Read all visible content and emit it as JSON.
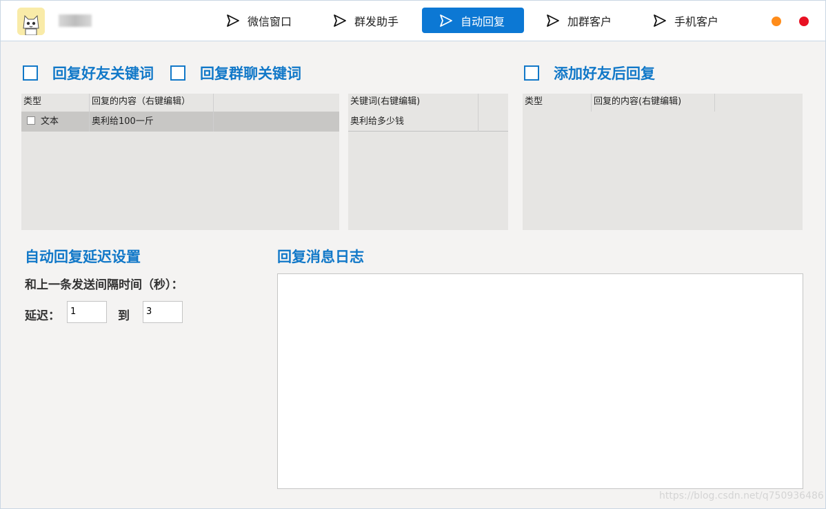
{
  "nav": {
    "tabs": [
      {
        "label": "微信窗口",
        "active": false
      },
      {
        "label": "群发助手",
        "active": false
      },
      {
        "label": "自动回复",
        "active": true
      },
      {
        "label": "加群客户",
        "active": false
      },
      {
        "label": "手机客户",
        "active": false
      }
    ]
  },
  "window_controls": {
    "minimize_color": "#ff8c1a",
    "close_color": "#e81123"
  },
  "keywords": {
    "friend_label": "回复好友关键词",
    "group_label": "回复群聊关键词",
    "after_add_label": "添加好友后回复"
  },
  "reply_table": {
    "col_type": "类型",
    "col_content": "回复的内容（右键编辑）",
    "rows": [
      {
        "type": "文本",
        "content": "奥利给100一斤"
      }
    ]
  },
  "keyword_table": {
    "col_keyword": "关键词(右键编辑)",
    "rows": [
      {
        "keyword": "奥利给多少钱"
      }
    ]
  },
  "add_reply_table": {
    "col_type": "类型",
    "col_content": "回复的内容(右键编辑)"
  },
  "delay": {
    "title": "自动回复延迟设置",
    "interval_label": "和上一条发送间隔时间（秒）：",
    "delay_label": "延迟：",
    "from_value": "1",
    "to_label": "到",
    "to_value": "3"
  },
  "log": {
    "title": "回复消息日志"
  },
  "watermark": "https://blog.csdn.net/q750936486",
  "colors": {
    "accent": "#1178c8",
    "active_tab": "#0c78d4"
  }
}
